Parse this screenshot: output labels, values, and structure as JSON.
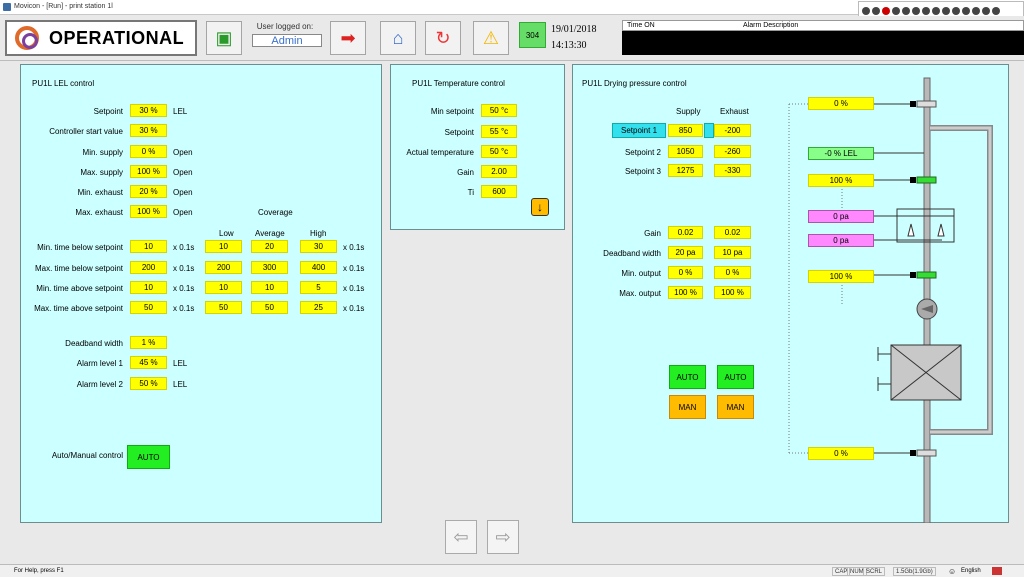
{
  "window": {
    "title": "Movicon - [Run] - print station 1l"
  },
  "header": {
    "status": "OPERATIONAL",
    "user_label": "User logged on:",
    "user_name": "Admin",
    "alarm_count": "304",
    "date": "19/01/2018",
    "time": "14:13:30",
    "alarm_col_time": "Time ON",
    "alarm_col_desc": "Alarm Description"
  },
  "lel": {
    "title": "PU1L LEL control",
    "setpoint": {
      "label": "Setpoint",
      "value": "30 %",
      "unit": "LEL"
    },
    "ctrl_start": {
      "label": "Controller start value",
      "value": "30 %"
    },
    "min_supply": {
      "label": "Min. supply",
      "value": "0 %",
      "unit": "Open"
    },
    "max_supply": {
      "label": "Max. supply",
      "value": "100 %",
      "unit": "Open"
    },
    "min_exhaust": {
      "label": "Min. exhaust",
      "value": "20 %",
      "unit": "Open"
    },
    "max_exhaust": {
      "label": "Max. exhaust",
      "value": "100 %",
      "unit": "Open"
    },
    "coverage_label": "Coverage",
    "cols": [
      "Low",
      "Average",
      "High"
    ],
    "rows": [
      {
        "label": "Min. time below setpoint",
        "value": "10",
        "unit": "x 0.1s",
        "low": "10",
        "avg": "20",
        "high": "30",
        "unit2": "x 0.1s"
      },
      {
        "label": "Max. time below setpoint",
        "value": "200",
        "unit": "x 0.1s",
        "low": "200",
        "avg": "300",
        "high": "400",
        "unit2": "x 0.1s"
      },
      {
        "label": "Min. time above setpoint",
        "value": "10",
        "unit": "x 0.1s",
        "low": "10",
        "avg": "10",
        "high": "5",
        "unit2": "x 0.1s"
      },
      {
        "label": "Max. time above setpoint",
        "value": "50",
        "unit": "x 0.1s",
        "low": "50",
        "avg": "50",
        "high": "25",
        "unit2": "x 0.1s"
      }
    ],
    "deadband": {
      "label": "Deadband width",
      "value": "1 %"
    },
    "alarm1": {
      "label": "Alarm level 1",
      "value": "45 %",
      "unit": "LEL"
    },
    "alarm2": {
      "label": "Alarm level 2",
      "value": "50 %",
      "unit": "LEL"
    },
    "auto_manual": {
      "label": "Auto/Manual control",
      "button": "AUTO"
    }
  },
  "temp": {
    "title": "PU1L Temperature control",
    "min_setpoint": {
      "label": "Min setpoint",
      "value": "50 °c"
    },
    "setpoint": {
      "label": "Setpoint",
      "value": "55 °c"
    },
    "actual": {
      "label": "Actual temperature",
      "value": "50 °c"
    },
    "gain": {
      "label": "Gain",
      "value": "2.00"
    },
    "ti": {
      "label": "Ti",
      "value": "600"
    }
  },
  "drying": {
    "title": "PU1L Drying pressure control",
    "col_supply": "Supply",
    "col_exhaust": "Exhaust",
    "setpoints": [
      {
        "label": "Setpoint 1",
        "supply": "850",
        "exhaust": "-200"
      },
      {
        "label": "Setpoint 2",
        "supply": "1050",
        "exhaust": "-260"
      },
      {
        "label": "Setpoint 3",
        "supply": "1275",
        "exhaust": "-330"
      }
    ],
    "gain": {
      "label": "Gain",
      "supply": "0.02",
      "exhaust": "0.02"
    },
    "deadband": {
      "label": "Deadband width",
      "supply": "20 pa",
      "exhaust": "10 pa"
    },
    "min_output": {
      "label": "Min. output",
      "supply": "0 %",
      "exhaust": "0 %"
    },
    "max_output": {
      "label": "Max. output",
      "supply": "100 %",
      "exhaust": "100 %"
    },
    "auto_label": "AUTO",
    "man_label": "MAN",
    "diagram": {
      "top_valve": "0 %",
      "lel": "-0 % LEL",
      "valve2": "100 %",
      "pressure1": "0 pa",
      "pressure2": "0 pa",
      "valve3": "100 %",
      "bottom_valve": "0 %"
    }
  },
  "statusbar": {
    "help": "For Help, press F1",
    "cap": "CAP",
    "num": "NUM",
    "scrl": "SCRL",
    "memory": "1.5Gb(1.9Gb)",
    "language": "English"
  }
}
